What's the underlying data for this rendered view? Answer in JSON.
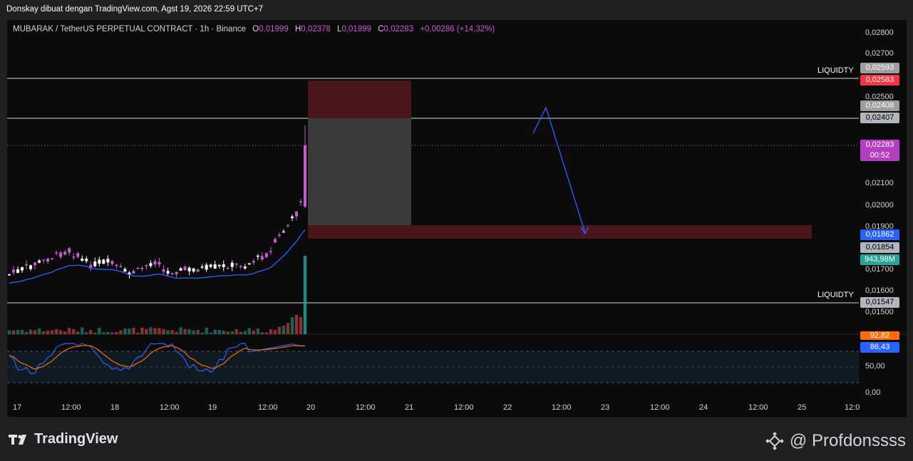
{
  "header": {
    "attribution": "Donskay dibuat dengan TradingView.com, Agst 19, 2026 22:59 UTC+7"
  },
  "legend": {
    "symbol": "MUBARAK / TetherUS PERPETUAL CONTRACT · 1h · Binance",
    "open_label": "O",
    "open": "0,01999",
    "high_label": "H",
    "high": "0,02378",
    "low_label": "L",
    "low": "0,01999",
    "close_label": "C",
    "close": "0,02283",
    "change": "+0,00286 (+14,32%)"
  },
  "price_axis": {
    "labels": [
      "0,02800",
      "0,02700",
      "0,02500",
      "0,02100",
      "0,02000",
      "0,01900",
      "0,01700",
      "0,01600",
      "0,01500"
    ],
    "tags": {
      "liq_top_gray": "0,02593",
      "liq_top_red": "0,02583",
      "entry_gray": "0,02408",
      "entry_white": "0,02407",
      "current_price": "0,02283",
      "countdown": "00:52",
      "blue_level": "0,01862",
      "gray_level": "0,01854",
      "volume": "943,98M",
      "liq_bottom": "0,01547"
    }
  },
  "annotations": {
    "liquidity_top": "LIQUIDTY",
    "liquidity_bottom": "LIQUIDTY"
  },
  "rsi_axis": {
    "tag_orange": "92,82",
    "tag_blue": "86,43",
    "label_50": "50,00",
    "label_0": "0,00"
  },
  "time_axis": {
    "labels": [
      "17",
      "12:00",
      "18",
      "12:00",
      "19",
      "12:00",
      "20",
      "12:00",
      "21",
      "12:00",
      "22",
      "12:00",
      "23",
      "12:00",
      "24",
      "12:00",
      "25",
      "12:0"
    ]
  },
  "footer": {
    "brand": "TradingView",
    "handle": "@ Profdonssss"
  },
  "colors": {
    "candle_purple": "#c75bd0",
    "candle_white": "#ffffff",
    "ma_blue": "#2962ff",
    "rsi_orange": "#ff6d00",
    "volume_green": "#26a69a",
    "volume_red": "#ef5350",
    "zone_red": "#5a1a1f",
    "zone_gray": "#3a3a3a",
    "arrow_blue": "#2962ff"
  }
}
